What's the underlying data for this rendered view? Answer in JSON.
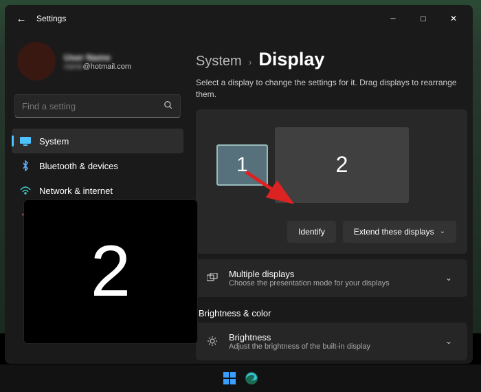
{
  "window": {
    "title": "Settings"
  },
  "user": {
    "name": "User Name",
    "email_prefix": "name",
    "email_domain": "@hotmail.com"
  },
  "search": {
    "placeholder": "Find a setting"
  },
  "nav": {
    "system": "System",
    "bluetooth": "Bluetooth & devices",
    "network": "Network & internet"
  },
  "breadcrumbs": {
    "parent": "System",
    "current": "Display"
  },
  "subtitle": "Select a display to change the settings for it. Drag displays to rearrange them.",
  "displays": {
    "d1": "1",
    "d2": "2"
  },
  "actions": {
    "identify": "Identify",
    "extend": "Extend these displays"
  },
  "multiple": {
    "title": "Multiple displays",
    "desc": "Choose the presentation mode for your displays"
  },
  "section_bc": "Brightness & color",
  "brightness": {
    "title": "Brightness",
    "desc": "Adjust the brightness of the built-in display"
  },
  "identify_overlay": "2"
}
